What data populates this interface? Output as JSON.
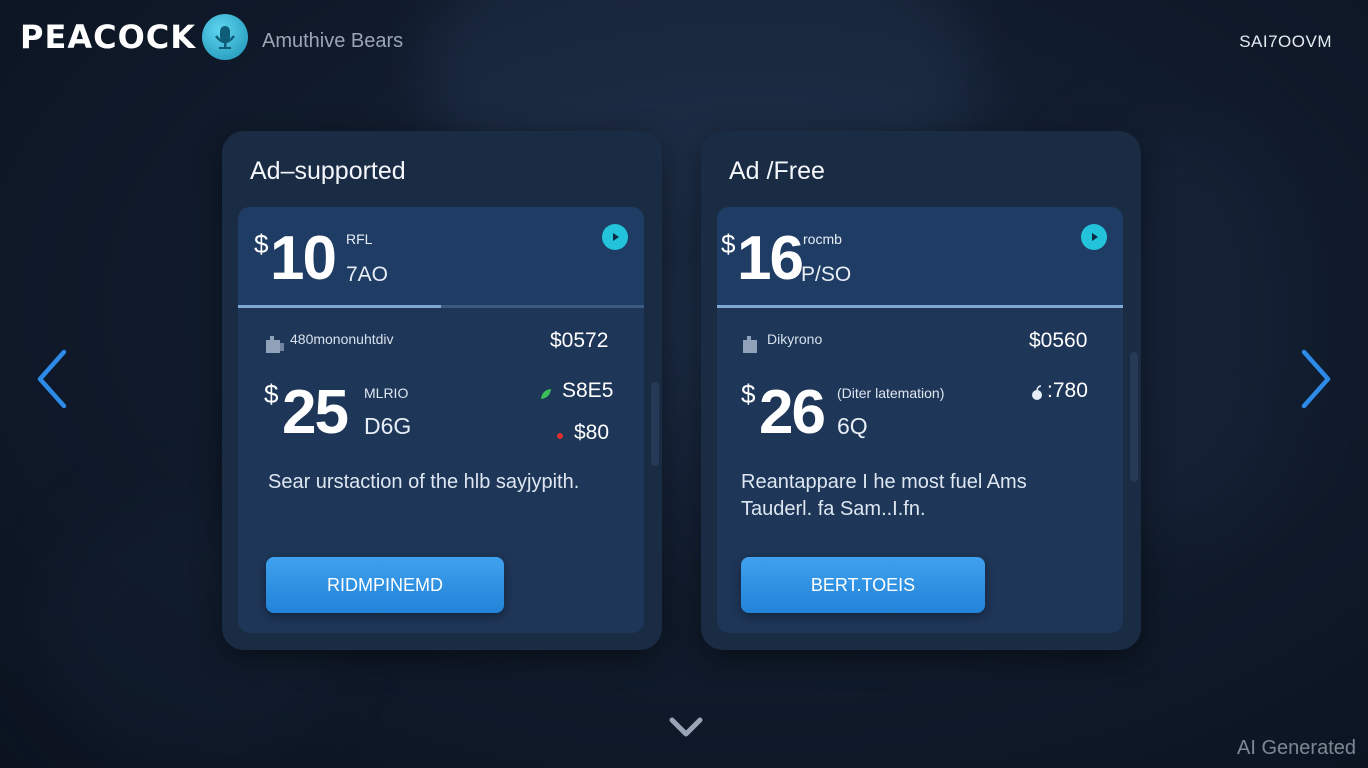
{
  "header": {
    "logo": "PEACOCK",
    "tagline": "Amuthive Bears",
    "account": "SAI7OOVM"
  },
  "icons": {
    "left_arrow": "chevron-left-icon",
    "right_arrow": "chevron-right-icon",
    "scroll_down": "chevron-down-icon",
    "play": "play-icon"
  },
  "colors": {
    "accent": "#22c3db",
    "button": "#2e8fe3",
    "card": "#1a2b44"
  },
  "plans": [
    {
      "title": "Ad–supported",
      "currency": "$",
      "price": "10",
      "period_top": "RFL",
      "period_bottom": "7AO",
      "progress": 0.5,
      "feature_label": "480mononuhtdiv",
      "feature_price": "$0572",
      "alt_currency": "$",
      "alt_price": "25",
      "alt_note": "MLRIO",
      "alt_unit": "D6G",
      "side_price_1": "S8E5",
      "side_price_2": "$80",
      "description": "Sear urstaction of the hlb sayjypith.",
      "cta": "RIDMPINEMD"
    },
    {
      "title": "Ad /Free",
      "currency": "$",
      "price": "16",
      "period_top": "rocmb",
      "period_bottom": "P/SO",
      "progress": 1,
      "feature_label": "Dikyrono",
      "feature_price": "$0560",
      "alt_currency": "$",
      "alt_price": "26",
      "alt_note": "(Diter latemation)",
      "alt_unit": "6Q",
      "side_price_1": ":780",
      "description": "Reantappare I he most fuel Ams Tauderl. fa Sam..I.fn.",
      "cta": "BERT.TOEIS"
    }
  ],
  "watermark": "AI Generated"
}
